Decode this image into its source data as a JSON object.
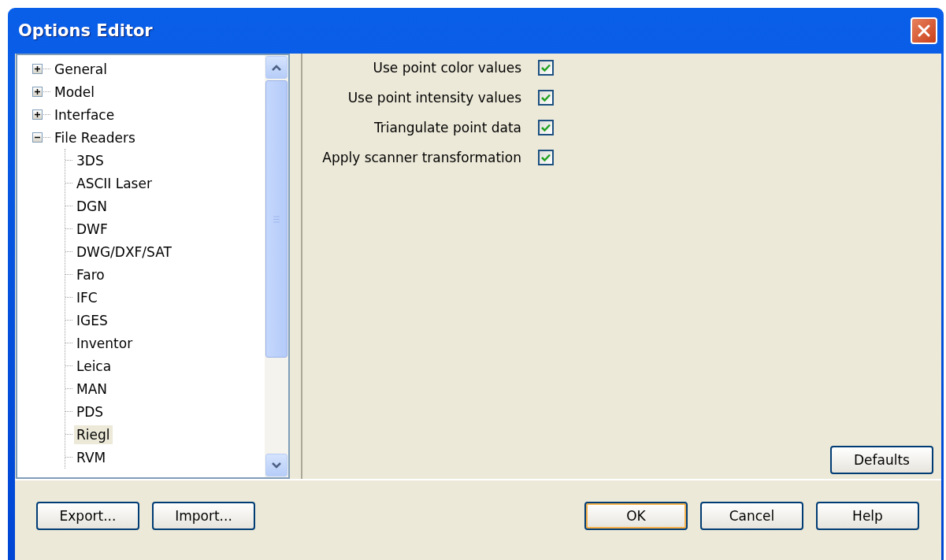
{
  "window": {
    "title": "Options Editor"
  },
  "tree": [
    {
      "label": "General",
      "expanded": false,
      "selected": false
    },
    {
      "label": "Model",
      "expanded": false,
      "selected": false
    },
    {
      "label": "Interface",
      "expanded": false,
      "selected": false
    },
    {
      "label": "File Readers",
      "expanded": true,
      "selected": false,
      "children": [
        {
          "label": "3DS",
          "selected": false
        },
        {
          "label": "ASCII Laser",
          "selected": false
        },
        {
          "label": "DGN",
          "selected": false
        },
        {
          "label": "DWF",
          "selected": false
        },
        {
          "label": "DWG/DXF/SAT",
          "selected": false
        },
        {
          "label": "Faro",
          "selected": false
        },
        {
          "label": "IFC",
          "selected": false
        },
        {
          "label": "IGES",
          "selected": false
        },
        {
          "label": "Inventor",
          "selected": false
        },
        {
          "label": "Leica",
          "selected": false
        },
        {
          "label": "MAN",
          "selected": false
        },
        {
          "label": "PDS",
          "selected": false
        },
        {
          "label": "Riegl",
          "selected": true
        },
        {
          "label": "RVM",
          "selected": false
        }
      ]
    }
  ],
  "options": [
    {
      "label": "Use point color values",
      "checked": true
    },
    {
      "label": "Use point intensity values",
      "checked": true
    },
    {
      "label": "Triangulate point data",
      "checked": true
    },
    {
      "label": "Apply scanner transformation",
      "checked": true
    }
  ],
  "defaults_button": "Defaults",
  "left_buttons": [
    "Export...",
    "Import..."
  ],
  "right_buttons": [
    {
      "label": "OK",
      "default": true
    },
    {
      "label": "Cancel",
      "default": false
    },
    {
      "label": "Help",
      "default": false
    }
  ]
}
